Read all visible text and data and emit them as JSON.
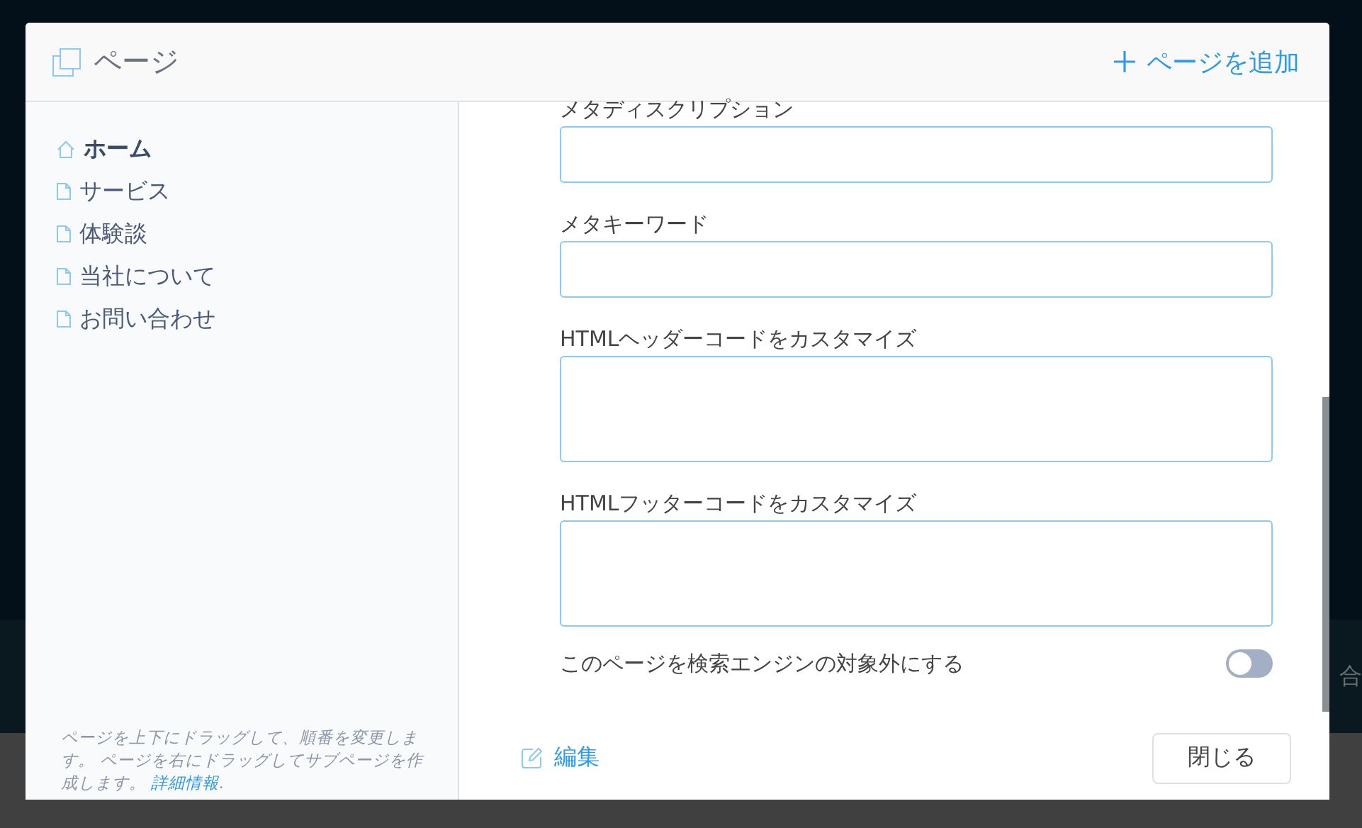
{
  "background": {
    "right_text": "合"
  },
  "dialog": {
    "title": "ページ",
    "add_button": "ページを追加"
  },
  "sidebar": {
    "items": [
      {
        "label": "ホーム",
        "kind": "home",
        "selected": true
      },
      {
        "label": "サービス",
        "kind": "page",
        "selected": false
      },
      {
        "label": "体験談",
        "kind": "page",
        "selected": false
      },
      {
        "label": "当社について",
        "kind": "page",
        "selected": false
      },
      {
        "label": "お問い合わせ",
        "kind": "page",
        "selected": false
      }
    ],
    "note": "ページを上下にドラッグして、順番を変更します。 ページを右にドラッグしてサブページを作成します。",
    "note_link": "詳細情報",
    "note_end": "."
  },
  "form": {
    "fields": [
      {
        "label": "メタディスクリプション",
        "kind": "input"
      },
      {
        "label": "メタキーワード",
        "kind": "input"
      },
      {
        "label": "HTMLヘッダーコードをカスタマイズ",
        "kind": "textarea"
      },
      {
        "label": "HTMLフッターコードをカスタマイズ",
        "kind": "textarea"
      }
    ],
    "toggle": {
      "label": "このページを検索エンジンの対象外にする",
      "on": false
    }
  },
  "footer": {
    "edit_link": "編集",
    "close_button": "閉じる"
  }
}
